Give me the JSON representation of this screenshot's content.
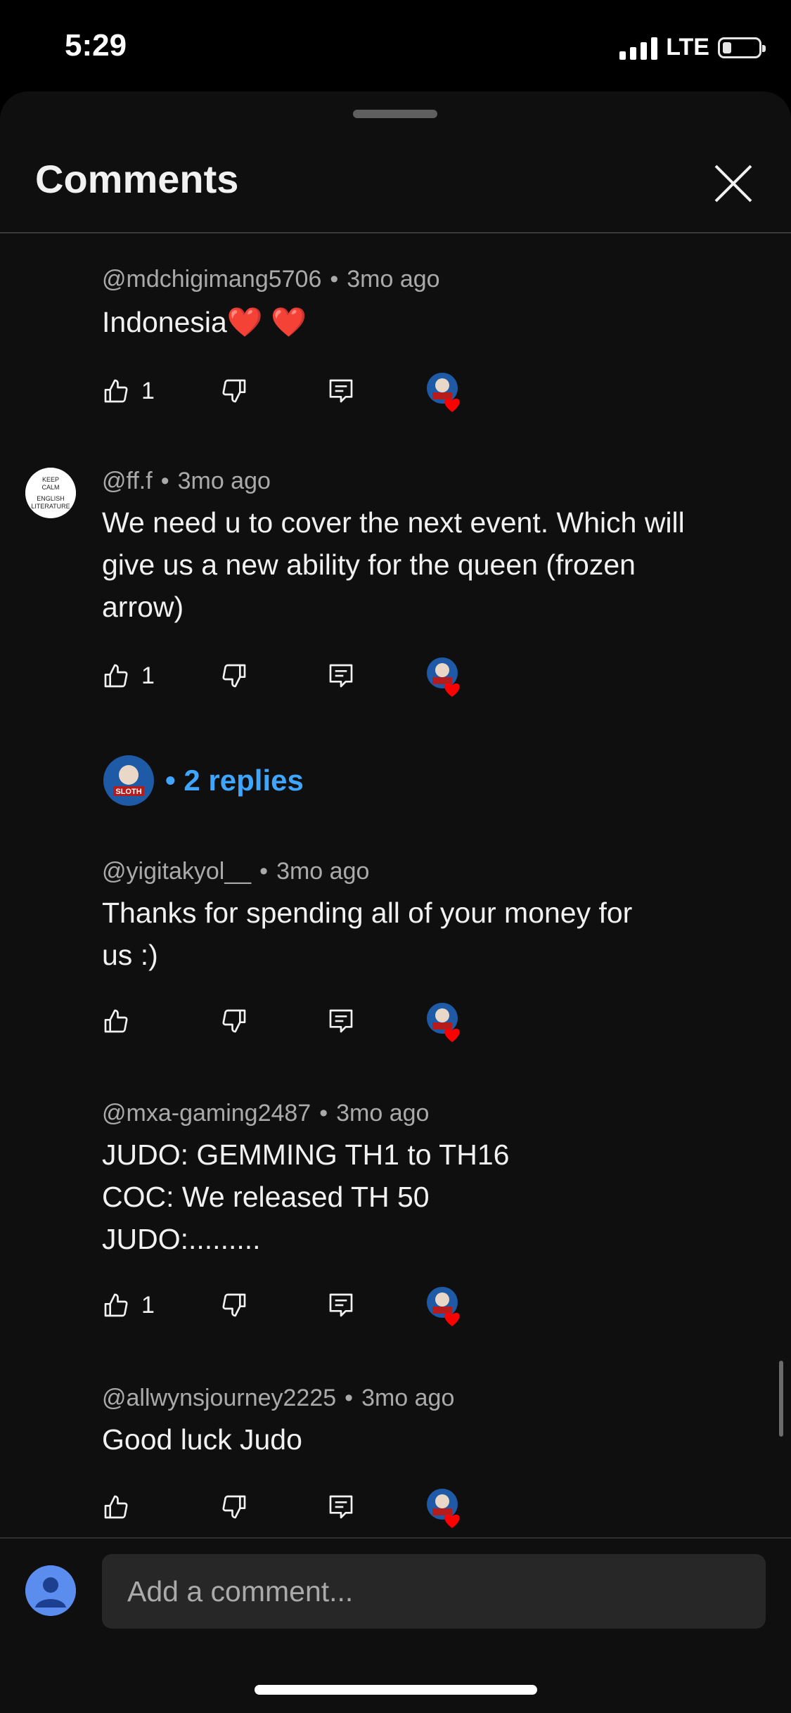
{
  "status": {
    "time": "5:29",
    "network": "LTE"
  },
  "sheet": {
    "title": "Comments"
  },
  "comments": [
    {
      "handle": "@mdchigimang5706",
      "age": "3mo ago",
      "lines": [
        "Indonesia❤️ ❤️"
      ],
      "likes": "1"
    },
    {
      "handle": "@ff.f",
      "age": "3mo ago",
      "lines": [
        "We need u to cover the next event. Which will",
        "give us a new ability for the queen (frozen",
        "arrow)"
      ],
      "likes": "1",
      "avatar_text": [
        "KEEP",
        "CALM",
        "ENGLISH",
        "LITERATURE"
      ]
    },
    {
      "handle": "@yigitakyol__",
      "age": "3mo ago",
      "lines": [
        "Thanks for spending all of your money for",
        "us :)"
      ],
      "likes": ""
    },
    {
      "handle": "@mxa-gaming2487",
      "age": "3mo ago",
      "lines": [
        "JUDO: GEMMING TH1 to TH16",
        "COC: We released TH 50",
        "JUDO:........."
      ],
      "likes": "1"
    },
    {
      "handle": "@allwynsjourney2225",
      "age": "3mo ago",
      "lines": [
        "Good luck Judo"
      ],
      "likes": ""
    }
  ],
  "replies": {
    "label": "2 replies",
    "separator": "•"
  },
  "composer": {
    "placeholder": "Add a comment..."
  },
  "creator_badge": {
    "text": "SLOTH"
  },
  "colors": {
    "accent": "#3ea6ff",
    "heart": "#ff0000",
    "background": "#0f0f0f"
  },
  "icons": [
    "like-icon",
    "dislike-icon",
    "reply-icon",
    "creator-heart-icon",
    "close-icon",
    "user-icon"
  ]
}
